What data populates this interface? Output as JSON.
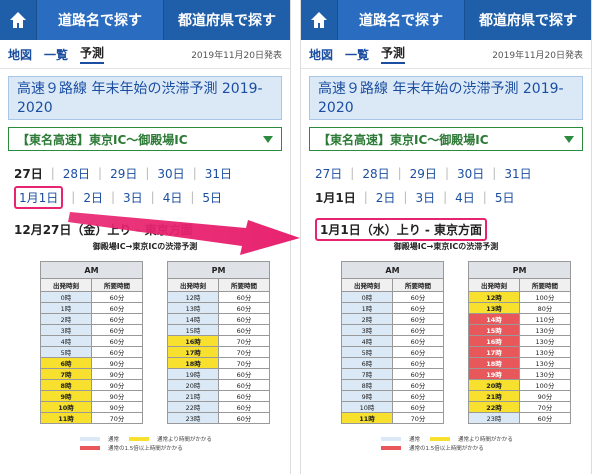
{
  "tabs": {
    "road": "道路名で探す",
    "prefecture": "都道府県で探す"
  },
  "subnav": {
    "map": "地図",
    "list": "一覧",
    "forecast": "予測",
    "published": "2019年11月20日発表"
  },
  "title": "高速９路線 年末年始の渋滞予測 2019-2020",
  "selector": "【東名高速】東京IC〜御殿場IC",
  "dates_row1": [
    "27日",
    "28日",
    "29日",
    "30日",
    "31日"
  ],
  "dates_row2": [
    "1月1日",
    "2日",
    "3日",
    "4日",
    "5日"
  ],
  "left": {
    "heading": "12月27日（金）上り - 東京方面",
    "subheading": "御殿場IC→東京ICの渋滞予測",
    "am": [
      [
        "0時",
        "60分",
        "n"
      ],
      [
        "1時",
        "60分",
        "n"
      ],
      [
        "2時",
        "60分",
        "n"
      ],
      [
        "3時",
        "60分",
        "n"
      ],
      [
        "4時",
        "60分",
        "n"
      ],
      [
        "5時",
        "60分",
        "n"
      ],
      [
        "6時",
        "90分",
        "y"
      ],
      [
        "7時",
        "90分",
        "y"
      ],
      [
        "8時",
        "90分",
        "y"
      ],
      [
        "9時",
        "90分",
        "y"
      ],
      [
        "10時",
        "90分",
        "y"
      ],
      [
        "11時",
        "70分",
        "y"
      ]
    ],
    "pm": [
      [
        "12時",
        "60分",
        "n"
      ],
      [
        "13時",
        "60分",
        "n"
      ],
      [
        "14時",
        "60分",
        "n"
      ],
      [
        "15時",
        "60分",
        "n"
      ],
      [
        "16時",
        "70分",
        "y"
      ],
      [
        "17時",
        "70分",
        "y"
      ],
      [
        "18時",
        "70分",
        "y"
      ],
      [
        "19時",
        "60分",
        "n"
      ],
      [
        "20時",
        "60分",
        "n"
      ],
      [
        "21時",
        "60分",
        "n"
      ],
      [
        "22時",
        "60分",
        "n"
      ],
      [
        "23時",
        "60分",
        "n"
      ]
    ]
  },
  "right": {
    "heading": "1月1日（水）上り - 東京方面",
    "subheading": "御殿場IC→東京ICの渋滞予測",
    "am": [
      [
        "0時",
        "60分",
        "n"
      ],
      [
        "1時",
        "60分",
        "n"
      ],
      [
        "2時",
        "60分",
        "n"
      ],
      [
        "3時",
        "60分",
        "n"
      ],
      [
        "4時",
        "60分",
        "n"
      ],
      [
        "5時",
        "60分",
        "n"
      ],
      [
        "6時",
        "60分",
        "n"
      ],
      [
        "7時",
        "60分",
        "n"
      ],
      [
        "8時",
        "60分",
        "n"
      ],
      [
        "9時",
        "60分",
        "n"
      ],
      [
        "10時",
        "60分",
        "n"
      ],
      [
        "11時",
        "70分",
        "y"
      ]
    ],
    "pm": [
      [
        "12時",
        "100分",
        "y"
      ],
      [
        "13時",
        "80分",
        "y"
      ],
      [
        "14時",
        "110分",
        "r"
      ],
      [
        "15時",
        "130分",
        "r"
      ],
      [
        "16時",
        "130分",
        "r"
      ],
      [
        "17時",
        "130分",
        "r"
      ],
      [
        "18時",
        "130分",
        "r"
      ],
      [
        "19時",
        "130分",
        "r"
      ],
      [
        "20時",
        "100分",
        "y"
      ],
      [
        "21時",
        "90分",
        "y"
      ],
      [
        "22時",
        "70分",
        "y"
      ],
      [
        "23時",
        "60分",
        "n"
      ]
    ]
  },
  "table_labels": {
    "am": "AM",
    "pm": "PM",
    "col_depart": "出発時刻",
    "col_time": "所要時間"
  },
  "legend": {
    "normal": "通常",
    "slow": "通常より時間がかかる",
    "heavy": "通常の1.5倍以上時間がかかる"
  },
  "colors": {
    "normal": "#dbe9f7",
    "slow": "#f7e12e",
    "heavy": "#e8585a",
    "highlight": "#e8236f"
  }
}
